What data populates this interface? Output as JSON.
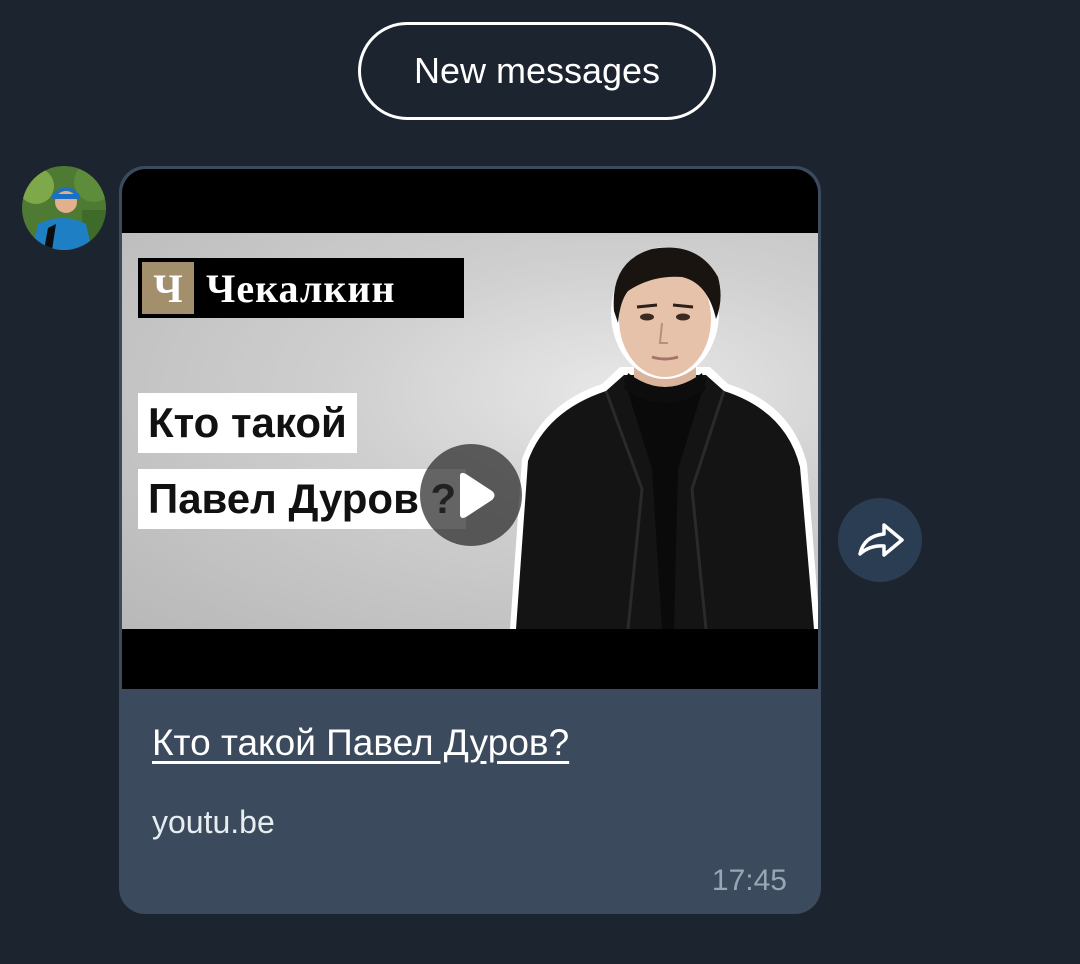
{
  "banner": {
    "label": "New messages"
  },
  "message": {
    "preview": {
      "brand_letter": "Ч",
      "brand_name": "Чекалкин",
      "caption_line1": "Кто такой",
      "caption_line2": "Павел Дуров ?"
    },
    "link_title": "Кто такой Павел Дуров?",
    "link_domain": "youtu.be",
    "time": "17:45"
  },
  "icons": {
    "play": "play-icon",
    "share": "share-icon",
    "avatar": "avatar"
  },
  "colors": {
    "background": "#1c2430",
    "bubble": "#3b4a5c",
    "share_button": "#2b3d52",
    "brand_gold": "#a48f6c"
  }
}
